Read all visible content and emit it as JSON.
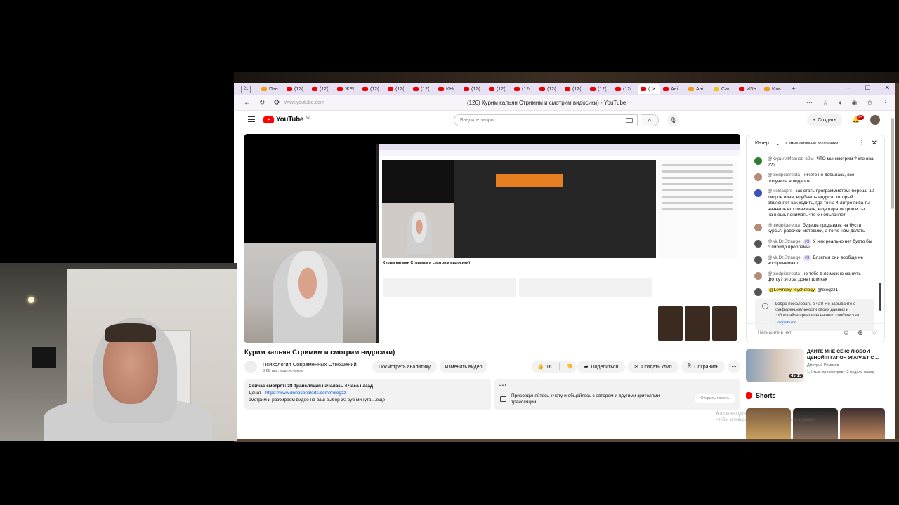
{
  "browser": {
    "tab_count": "21",
    "tabs": [
      {
        "label": "Пан",
        "fav": "orange"
      },
      {
        "label": "(12(",
        "fav": "red"
      },
      {
        "label": "(12(",
        "fav": "red"
      },
      {
        "label": "ЖЕІ",
        "fav": "red"
      },
      {
        "label": "(12(",
        "fav": "red"
      },
      {
        "label": "(12(",
        "fav": "red"
      },
      {
        "label": "(12(",
        "fav": "red"
      },
      {
        "label": "ИН(",
        "fav": "red"
      },
      {
        "label": "(12(",
        "fav": "red"
      },
      {
        "label": "(12(",
        "fav": "red"
      },
      {
        "label": "(12(",
        "fav": "red"
      },
      {
        "label": "(12(",
        "fav": "red"
      },
      {
        "label": "(12(",
        "fav": "red"
      },
      {
        "label": "(12(",
        "fav": "red"
      },
      {
        "label": "(12(",
        "fav": "red"
      }
    ],
    "active_tab": "(",
    "tabs_after": [
      {
        "label": "Ані",
        "fav": "red"
      },
      {
        "label": "Ані",
        "fav": "orange"
      },
      {
        "label": "Сал",
        "fav": "yellow"
      },
      {
        "label": "ИЗЬ",
        "fav": "red"
      },
      {
        "label": "Иль",
        "fav": "orange"
      }
    ],
    "url": "www.youtube.com",
    "page_title": "(126) Курим кальян Стримим и смотрим видосики) - YouTube"
  },
  "youtube": {
    "logo_text": "YouTube",
    "logo_region": "KZ",
    "search_placeholder": "Введите запрос",
    "create_label": "Создать",
    "notifications_badge": "9+"
  },
  "video": {
    "title": "Курим кальян Стримим и смотрим видосики)",
    "channel_name": "Психология Современных Отношений",
    "channel_subs": "3,66 тыс. подписчиков",
    "btn_analytics": "Посмотреть аналитику",
    "btn_edit": "Изменить видео",
    "likes": "16",
    "btn_share": "Поделиться",
    "btn_clip": "Создать клип",
    "btn_save": "Сохранить",
    "desc_line1": "Сейчас смотрят: 38  Трансляция началась 4 часа назад",
    "desc_donate_label": "Донат",
    "desc_donate_link": "https://www.donationalerts.com/r/olegzz",
    "desc_line3": "смотрим и разбираем видео на ваш выбор 30 руб минута ...ещё",
    "chat_label": "Чат",
    "chat_text": "Присоединяйтесь к чату и общайтесь с автором и другими зрителями трансляции.",
    "open_panel": "Открыть панель"
  },
  "inner_capture": {
    "title": "Курим кальян Стримим и смотрим видосики)"
  },
  "chat": {
    "header_mode": "Интер...",
    "header_filter": "Самые активные поклонники",
    "messages": [
      {
        "author": "@КириллИванов-в2ш",
        "text": "ЧТО мы смотрим ? кто она ???",
        "avatar": "green"
      },
      {
        "author": "@piedpiperepta",
        "text": "ничего не добилась, все получила в подарок",
        "avatar": "brown"
      },
      {
        "author": "@kieBaxpro",
        "text": "как стать программистом: берешь 10 литров пива, врубаешь индуса, который объясняет как кодить, где-то на 4 литре пива ты начнешь его понимать, еще пара литров и ты начнешь понимать что он объясняет",
        "avatar": "blue"
      },
      {
        "author": "@piedpiperepta",
        "text": "будешь продавать на бусти курсы? рабочей методики, а то чо нам делать",
        "avatar": "brown"
      },
      {
        "author": "@Mr.Dr.Strange",
        "badge": "#3",
        "text": "У них реально нет будто бы с либидо проблемы",
        "avatar": "dark"
      },
      {
        "author": "@Mr.Dr.Strange",
        "badge": "#3",
        "text": "Блэкпил они вообще не воспринимают...",
        "avatar": "dark"
      },
      {
        "author": "@piedpiperepta",
        "text": "чо тебе в лс можно скинуть фотку? это за донат или как",
        "avatar": "brown"
      },
      {
        "author": "",
        "highlight": "@LevinskyPsychology",
        "text": "@olegzz1",
        "avatar": "dark"
      }
    ],
    "welcome_text": "Добро пожаловать в чат! Не забывайте о конфиденциальности своих данных и соблюдайте принципы нашего сообщества.",
    "welcome_more": "Подробнее",
    "input_placeholder": "Напишите в чат"
  },
  "recommendation": {
    "title": "ДАЙТЕ МНЕ СЕКС ЛЮБОЙ ЦЕНОЙ!!! ГАПОН УГАРАЕТ С ...",
    "channel": "Дмитрий Ремизов",
    "meta": "1,5 тыс. просмотров • 2 недели назад",
    "duration": "45:15"
  },
  "shorts_label": "Shorts",
  "watermark": {
    "line1": "Активация Windows",
    "line2": "Чтобы активировать Windows, перейдите в раздел"
  }
}
